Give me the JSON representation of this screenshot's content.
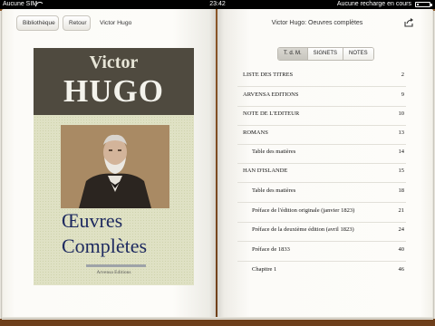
{
  "status_bar": {
    "carrier": "Aucune SIM",
    "time": "23:42",
    "charge_status": "Aucune recharge en cours",
    "battery_level": 0.15
  },
  "toolbar_left": {
    "library_label": "Bibliothèque",
    "back_label": "Retour",
    "book_author": "Victor Hugo"
  },
  "toolbar_right": {
    "book_title": "Victor Hugo: Oeuvres complètes",
    "share_icon": "share-icon"
  },
  "cover": {
    "author_first": "Victor",
    "author_last": "HUGO",
    "title_line1": "Œuvres",
    "title_line2": "Complètes",
    "publisher": "Arvensa Editions"
  },
  "segments": {
    "items": [
      "T. d. M.",
      "SIGNETS",
      "NOTES"
    ],
    "selected": "T. d. M."
  },
  "toc": {
    "entries": [
      {
        "title": "LISTE DES TITRES",
        "page": "2"
      },
      {
        "title": "ARVENSA EDITIONS",
        "page": "9"
      },
      {
        "title": "NOTE DE L'EDITEUR",
        "page": "10"
      },
      {
        "title": "ROMANS",
        "page": "13"
      },
      {
        "title": "Table des matières",
        "page": "14"
      },
      {
        "title": "HAN D'ISLANDE",
        "page": "15"
      },
      {
        "title": "Table des matières",
        "page": "18"
      },
      {
        "title": "Préface de l'édition originale (janvier 1823)",
        "page": "21"
      },
      {
        "title": "Préface de la deuxième édition (avril 1823)",
        "page": "24"
      },
      {
        "title": "Préface de 1833",
        "page": "40"
      },
      {
        "title": "Chapitre 1",
        "page": "46"
      }
    ]
  },
  "colors": {
    "leather": "#7a4a24",
    "cover_band": "#4f4a3f",
    "cover_title": "#1e2a60"
  }
}
